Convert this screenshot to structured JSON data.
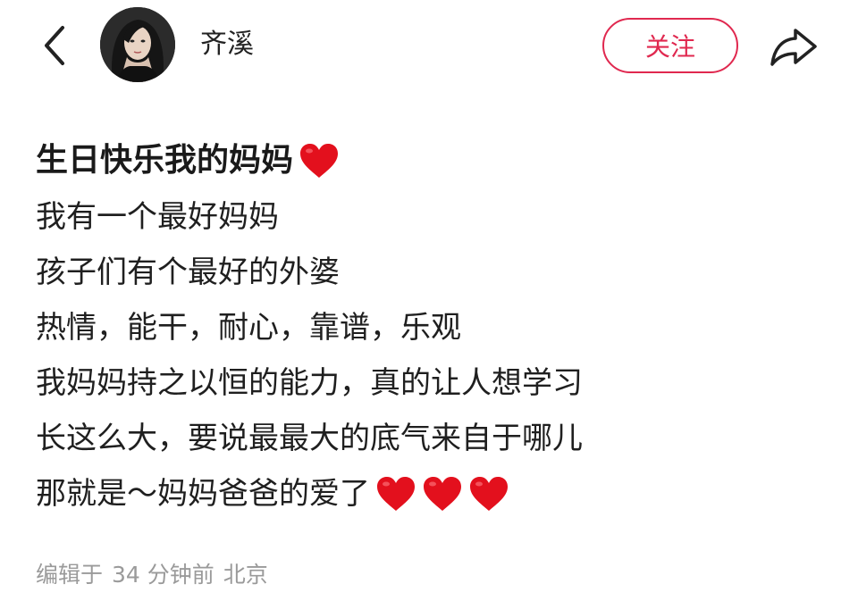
{
  "header": {
    "back_icon": "chevron-left-icon",
    "username": "齐溪",
    "follow_label": "关注",
    "share_icon": "share-icon",
    "accent_color": "#e0284f"
  },
  "post": {
    "title": "生日快乐我的妈妈",
    "lines": [
      "我有一个最好妈妈",
      "孩子们有个最好的外婆",
      "热情，能干，耐心，靠谱，乐观",
      "我妈妈持之以恒的能力，真的让人想学习",
      "长这么大，要说最最大的底气来自于哪儿",
      "那就是～妈妈爸爸的爱了"
    ],
    "heart_icon": "red-heart-emoji"
  },
  "meta": {
    "edited": "编辑于",
    "time": "34 分钟前",
    "location": "北京"
  }
}
